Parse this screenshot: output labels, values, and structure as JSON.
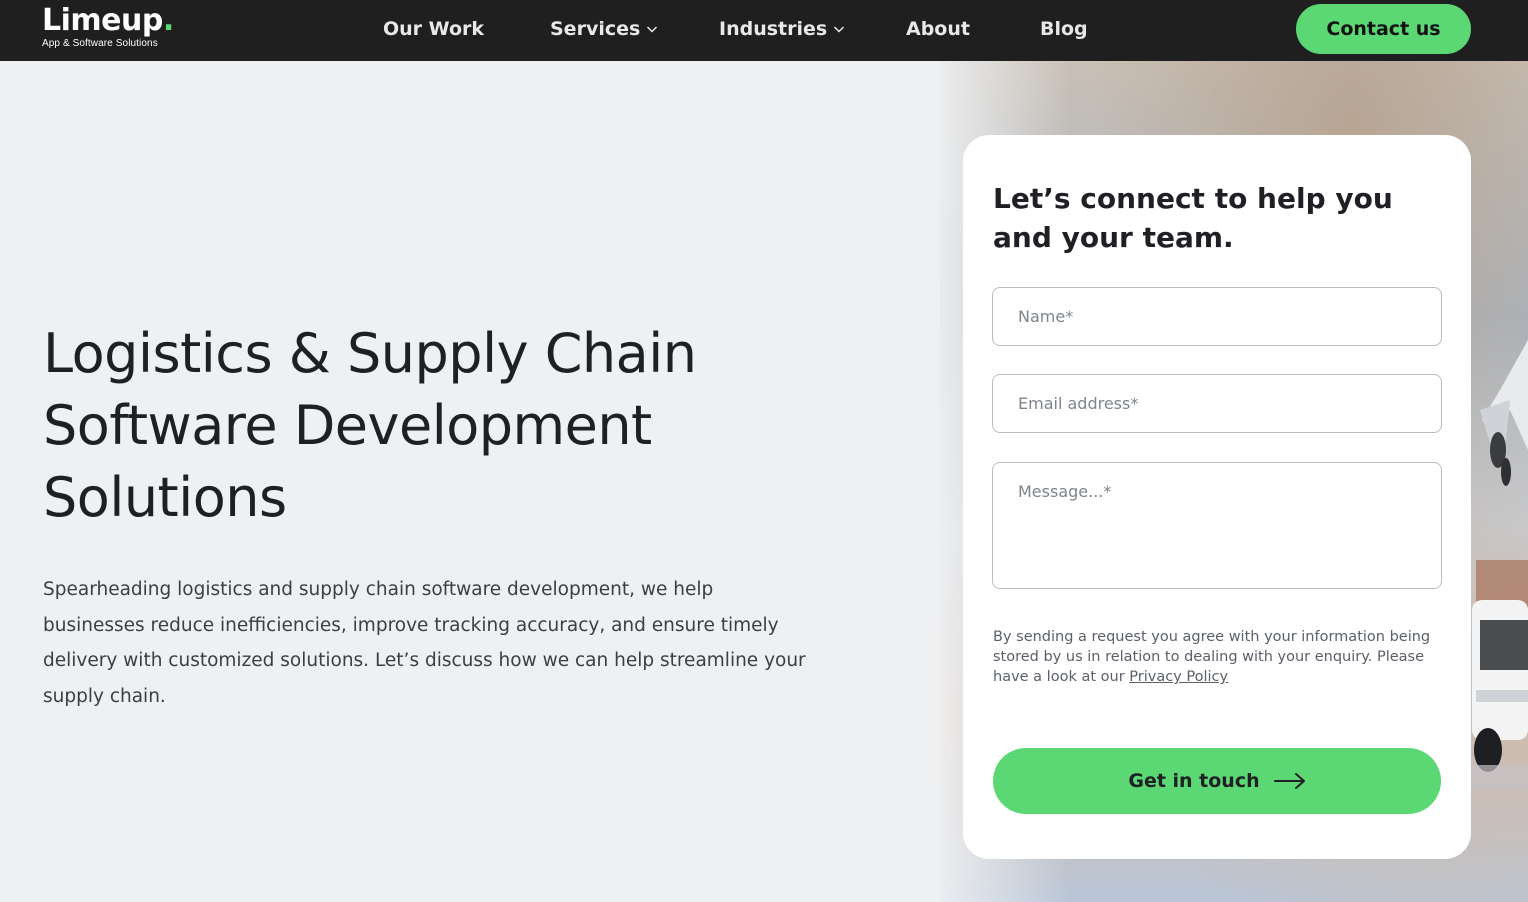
{
  "header": {
    "logo_text": "Limeup",
    "logo_dot": ".",
    "logo_tagline": "App & Software Solutions",
    "nav": [
      {
        "label": "Our Work",
        "dropdown": false
      },
      {
        "label": "Services",
        "dropdown": true
      },
      {
        "label": "Industries",
        "dropdown": true
      },
      {
        "label": "About",
        "dropdown": false
      },
      {
        "label": "Blog",
        "dropdown": false
      }
    ],
    "cta_label": "Contact us"
  },
  "hero": {
    "title_line1": "Logistics & Supply Chain",
    "title_line2": "Software Development",
    "title_line3": "Solutions",
    "description": "Spearheading logistics and supply chain software development, we help businesses reduce inefficiencies, improve tracking accuracy, and ensure timely delivery with customized solutions. Let’s discuss how we can help streamline your supply chain."
  },
  "form": {
    "title": "Let’s connect to help you and your team.",
    "name_placeholder": "Name*",
    "email_placeholder": "Email address*",
    "message_placeholder": "Message...*",
    "consent_text": "By sending a request you agree with your information being stored by us in relation to dealing with your enquiry. Please have a look at our ",
    "privacy_link": "Privacy Policy",
    "submit_label": "Get in touch"
  },
  "colors": {
    "accent": "#5bd774",
    "header_bg": "#1f1f1f",
    "page_bg": "#eef0f2",
    "card_bg": "#ffffff"
  },
  "icons": [
    "chevron-down-icon",
    "arrow-right-icon"
  ]
}
